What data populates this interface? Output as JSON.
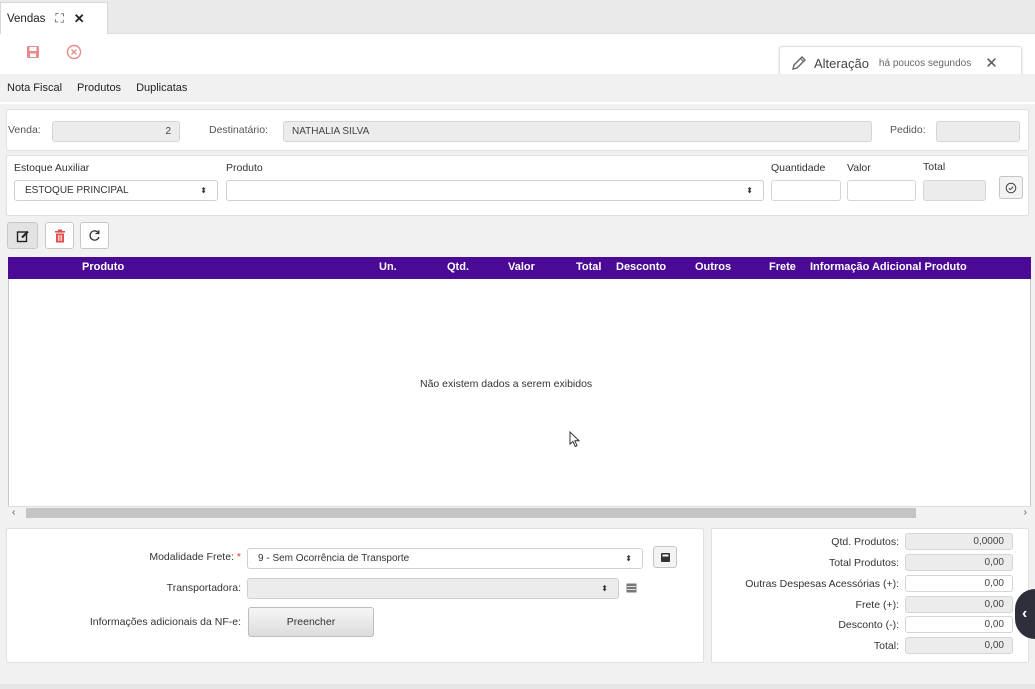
{
  "tab": {
    "title": "Vendas"
  },
  "notice": {
    "title": "Alteração",
    "time": "há poucos segundos"
  },
  "subnav": {
    "items": [
      "Nota Fiscal",
      "Produtos",
      "Duplicatas"
    ]
  },
  "header": {
    "venda_label": "Venda:",
    "venda_value": "2",
    "destinatario_label": "Destinatário:",
    "destinatario_value": "NATHALIA SILVA",
    "pedido_label": "Pedido:",
    "pedido_value": ""
  },
  "product_form": {
    "estoque_label": "Estoque Auxiliar",
    "estoque_value": "ESTOQUE PRINCIPAL",
    "produto_label": "Produto",
    "produto_value": "",
    "quantidade_label": "Quantidade",
    "valor_label": "Valor",
    "total_label": "Total"
  },
  "grid": {
    "columns": [
      "Produto",
      "Un.",
      "Qtd.",
      "Valor",
      "Total",
      "Desconto",
      "Outros",
      "Frete",
      "Informação Adicional Produto"
    ],
    "empty_message": "Não existem dados a serem exibidos"
  },
  "frete": {
    "modalidade_label": "Modalidade Frete:",
    "required_mark": "*",
    "modalidade_value": "9 - Sem Ocorrência de Transporte",
    "transportadora_label": "Transportadora:",
    "transportadora_value": "",
    "info_label": "Informações adicionais da NF-e:",
    "fill_button": "Preencher"
  },
  "totals": [
    {
      "label": "Qtd. Produtos:",
      "value": "0,0000",
      "editable": false
    },
    {
      "label": "Total Produtos:",
      "value": "0,00",
      "editable": false
    },
    {
      "label": "Outras Despesas Acessórias (+):",
      "value": "0,00",
      "editable": true
    },
    {
      "label": "Frete (+):",
      "value": "0,00",
      "editable": false
    },
    {
      "label": "Desconto (-):",
      "value": "0,00",
      "editable": true
    },
    {
      "label": "Total:",
      "value": "0,00",
      "editable": false
    }
  ],
  "colors": {
    "grid_header": "#4b0a95",
    "save_icon": "#e88a8a",
    "delete_icon": "#e24c4c"
  }
}
